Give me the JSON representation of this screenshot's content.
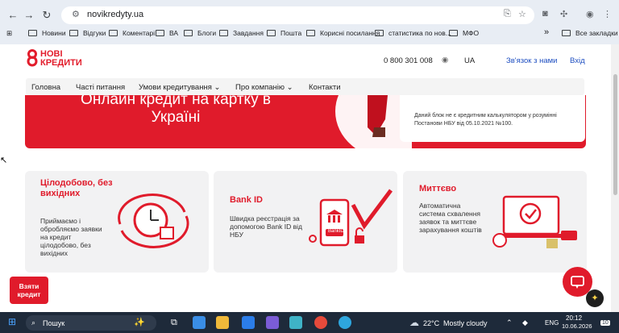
{
  "browser": {
    "url": "novikredyty.ua",
    "bookmarks": [
      "Новини",
      "Відгуки",
      "Коментарі",
      "ВА",
      "Блоги",
      "Завдання",
      "Пошта",
      "Корисні посилання",
      "статистика по нов...",
      "МФО"
    ],
    "overflow": "»",
    "all_bookmarks": "Все закладки"
  },
  "header": {
    "logo_line1": "НОВІ",
    "logo_line2": "КРЕДИТИ",
    "phone": "0 800 301 008",
    "lang": "UA",
    "contact_link": "Зв'язок з нами",
    "login_link": "Вхід"
  },
  "menu": {
    "items": [
      "Головна",
      "Часті питання",
      "Умови кредитування",
      "Про компанію",
      "Контакти"
    ]
  },
  "hero": {
    "title": "Онлайн кредит на картку в Україні",
    "note": "Даний блок не є кредитним калькулятором у розумінні Постанови НБУ від 05.10.2021 №100."
  },
  "cards": [
    {
      "title": "Цілодобово, без вихідних",
      "text": "Приймаємо і обробляємо заявки на кредит цілодобово, без вихідних"
    },
    {
      "title": "Bank ID",
      "text": "Швидка реєстрація за допомогою Bank ID від НБУ",
      "illustration_label": "BankID"
    },
    {
      "title": "Миттєво",
      "text": "Автоматична система схвалення заявок та миттєве зарахування коштів"
    }
  ],
  "cta": {
    "label": "Взяти кредит"
  },
  "taskbar": {
    "search": "Пошук",
    "weather": "22°C",
    "weather_desc": "Mostly cloudy",
    "lang": "ENG",
    "time": "20:12",
    "date": "10.06.2026",
    "notif": "10"
  },
  "colors": {
    "accent": "#e01b2b",
    "link": "#1f4fc1"
  }
}
